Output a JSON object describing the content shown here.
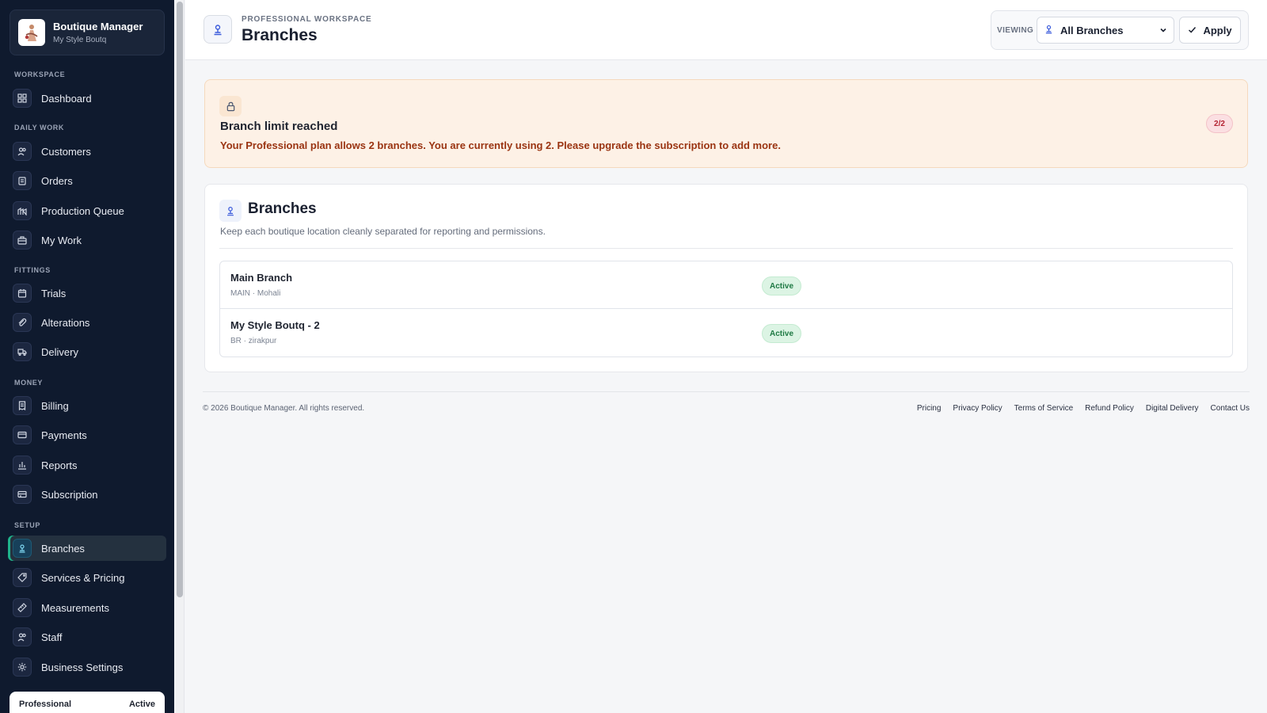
{
  "brand": {
    "name": "Boutique Manager",
    "subtitle": "My Style Boutq"
  },
  "sidebar": {
    "sections": {
      "workspace": "WORKSPACE",
      "daily": "DAILY WORK",
      "fittings": "FITTINGS",
      "money": "MONEY",
      "setup": "SETUP"
    },
    "items": {
      "dashboard": "Dashboard",
      "customers": "Customers",
      "orders": "Orders",
      "production": "Production Queue",
      "mywork": "My Work",
      "trials": "Trials",
      "alterations": "Alterations",
      "delivery": "Delivery",
      "billing": "Billing",
      "payments": "Payments",
      "reports": "Reports",
      "subscription": "Subscription",
      "branches": "Branches",
      "services": "Services & Pricing",
      "measurements": "Measurements",
      "staff": "Staff",
      "settings": "Business Settings"
    },
    "active_item": "branches",
    "plan": {
      "name": "Professional",
      "status": "Active"
    }
  },
  "header": {
    "eyebrow": "PROFESSIONAL WORKSPACE",
    "title": "Branches",
    "viewing_label": "VIEWING",
    "branch_selected": "All Branches",
    "apply_label": "Apply"
  },
  "alert": {
    "title": "Branch limit reached",
    "message": "Your Professional plan allows 2 branches. You are currently using 2. Please upgrade the subscription to add more.",
    "badge": "2/2"
  },
  "branches_card": {
    "title": "Branches",
    "subtitle": "Keep each boutique location cleanly separated for reporting and permissions.",
    "rows": [
      {
        "name": "Main Branch",
        "meta": "MAIN · Mohali",
        "status": "Active"
      },
      {
        "name": "My Style Boutq - 2",
        "meta": "BR · zirakpur",
        "status": "Active"
      }
    ]
  },
  "footer": {
    "copyright": "© 2026 Boutique Manager. All rights reserved.",
    "links": [
      "Pricing",
      "Privacy Policy",
      "Terms of Service",
      "Refund Policy",
      "Digital Delivery",
      "Contact Us"
    ]
  },
  "colors": {
    "sidebar_bg": "#0f1a2e",
    "accent": "#1fb38b",
    "alert_bg": "#fdf1e6",
    "alert_text": "#9a3412",
    "active_badge": "#1f7a44"
  },
  "icons": {
    "dashboard": "grid-icon",
    "customers": "users-icon",
    "orders": "clipboard-icon",
    "production": "factory-icon",
    "mywork": "briefcase-icon",
    "trials": "calendar-icon",
    "alterations": "paperclip-icon",
    "delivery": "truck-icon",
    "billing": "receipt-icon",
    "payments": "credit-card-icon",
    "reports": "bar-chart-icon",
    "subscription": "card-icon",
    "branches": "branch-icon",
    "services": "tag-icon",
    "measurements": "ruler-icon",
    "staff": "users-icon",
    "settings": "gear-icon"
  }
}
